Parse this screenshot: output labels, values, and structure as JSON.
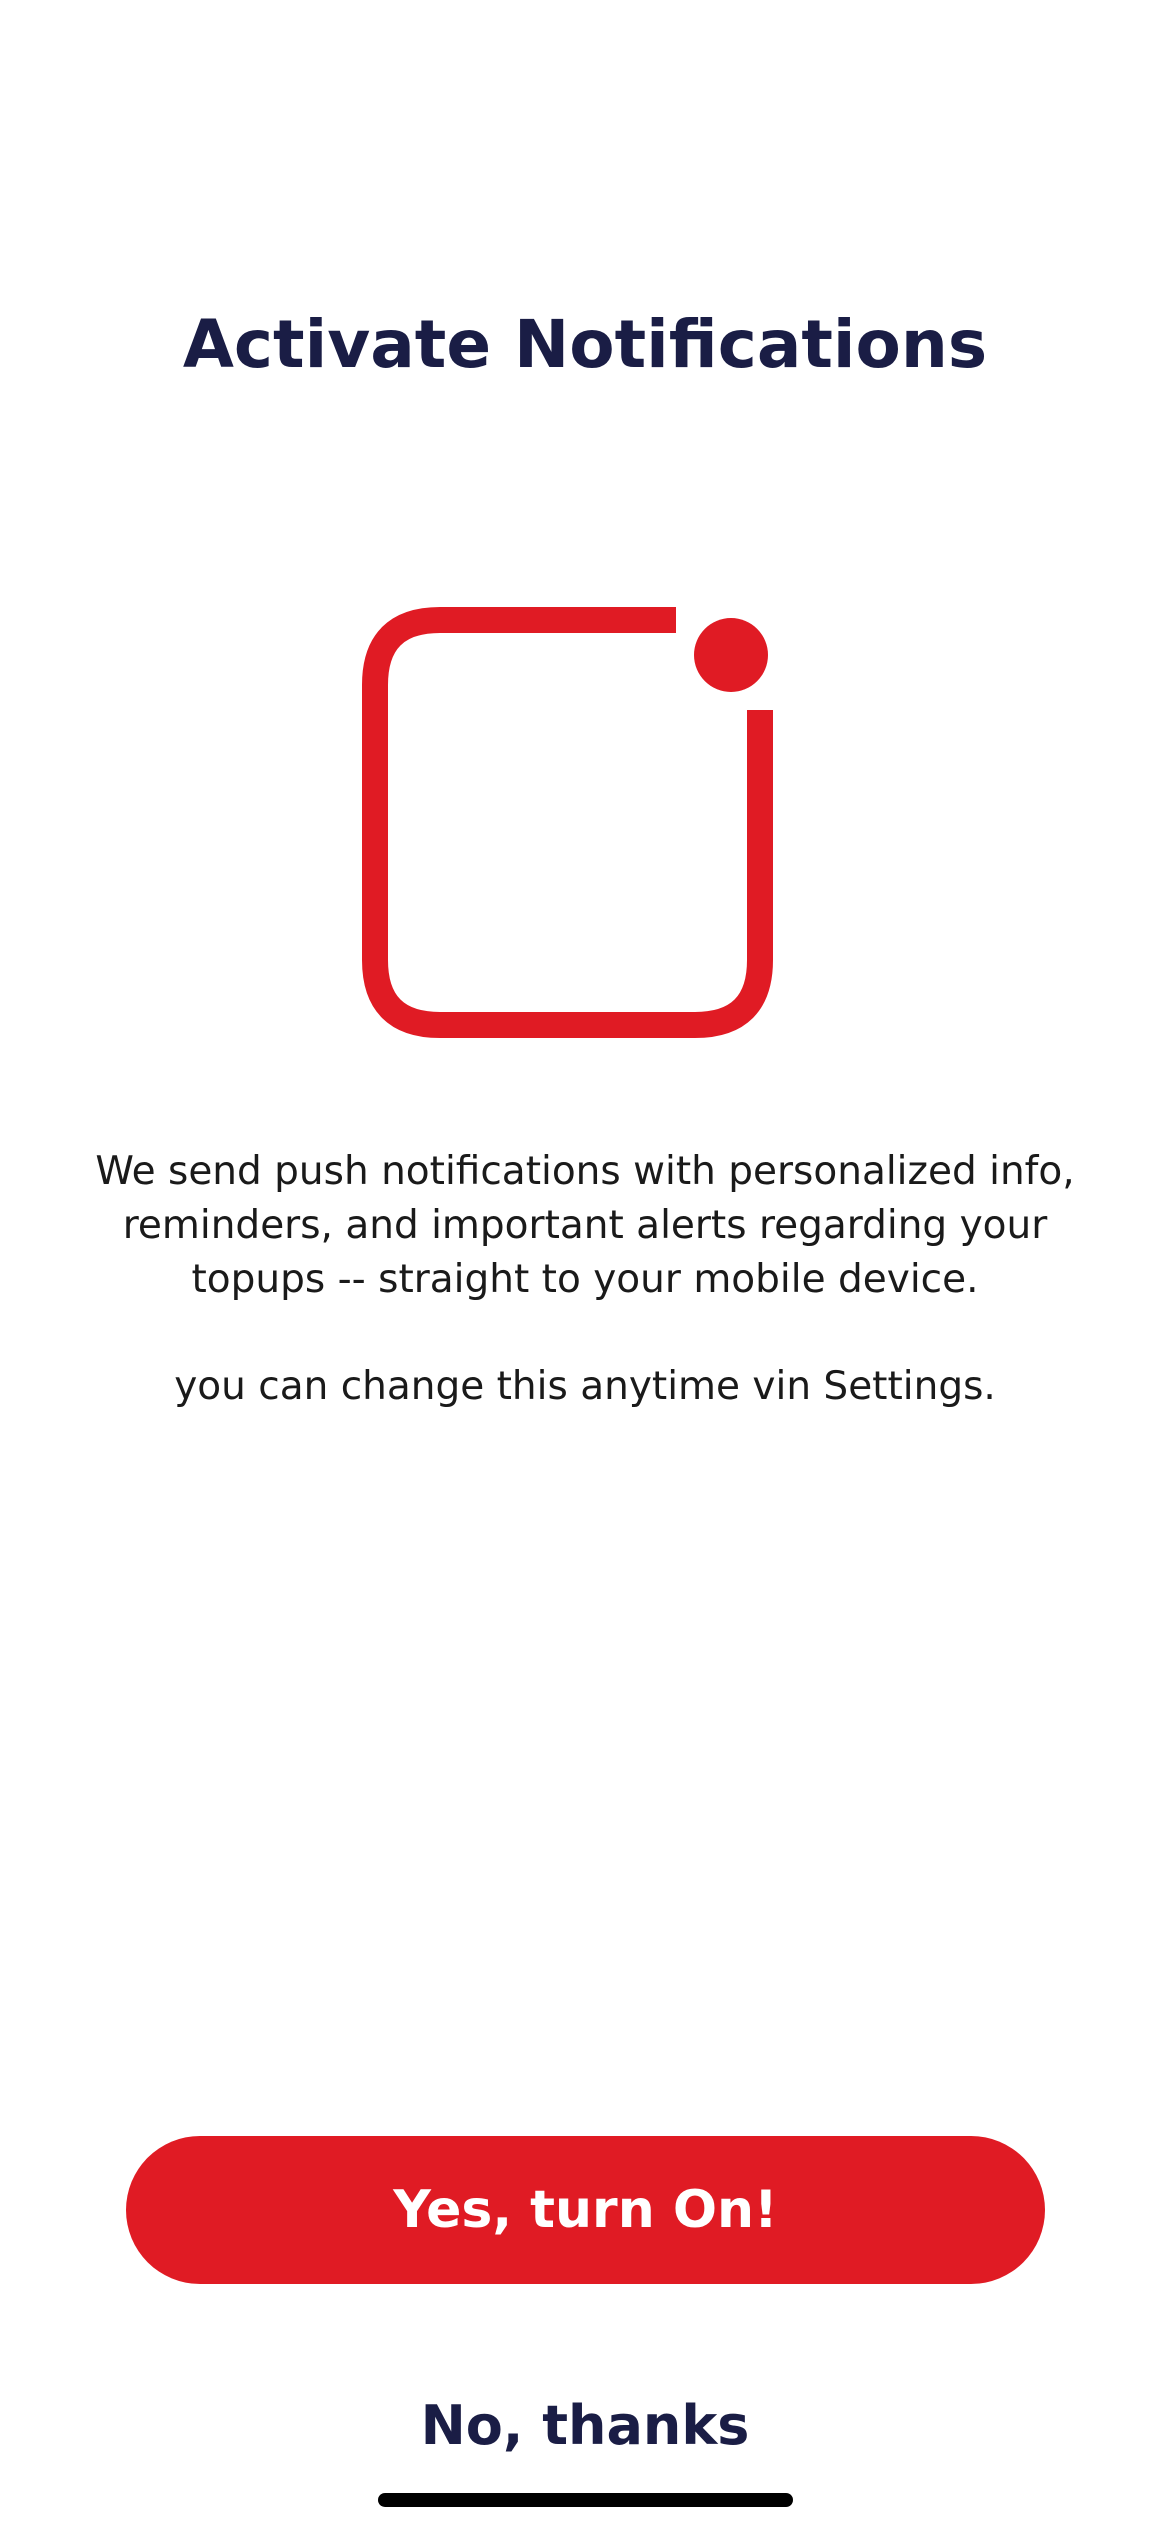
{
  "screen": {
    "title": "Activate Notifications",
    "description": "We send push notifications with  personalized info, reminders, and important alerts regarding your topups -- straight to your mobile device.",
    "note": "you can change this anytime vin Settings.",
    "icon": "notification-badge-icon",
    "colors": {
      "accent": "#e01b24",
      "title": "#1a1d45",
      "body_text": "#1a1a1a",
      "background": "#ffffff"
    }
  },
  "actions": {
    "primary_label": "Yes, turn On!",
    "secondary_label": "No, thanks"
  }
}
